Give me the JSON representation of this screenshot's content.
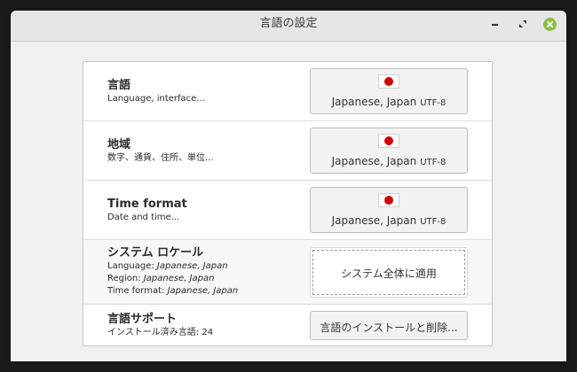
{
  "window": {
    "title": "言語の設定"
  },
  "rows": [
    {
      "title": "言語",
      "subtitle": "Language, interface...",
      "button": {
        "value": "Japanese, Japan",
        "encoding": "UTF-8",
        "flag": "japan-flag-icon"
      }
    },
    {
      "title": "地域",
      "subtitle": "数字、通貨、住所、単位...",
      "button": {
        "value": "Japanese, Japan",
        "encoding": "UTF-8",
        "flag": "japan-flag-icon"
      }
    },
    {
      "title": "Time format",
      "subtitle": "Date and time...",
      "button": {
        "value": "Japanese, Japan",
        "encoding": "UTF-8",
        "flag": "japan-flag-icon"
      }
    }
  ],
  "system_locale": {
    "title": "システム ロケール",
    "language_label": "Language:",
    "language_value": "Japanese, Japan",
    "region_label": "Region:",
    "region_value": "Japanese, Japan",
    "time_label": "Time format:",
    "time_value": "Japanese, Japan",
    "apply_button": "システム全体に適用"
  },
  "language_support": {
    "title": "言語サポート",
    "installed_text": "インストール済み言語: 24",
    "install_button": "言語のインストールと削除..."
  },
  "colors": {
    "close_button": "#8cbf48",
    "flag_red": "#d10000"
  }
}
